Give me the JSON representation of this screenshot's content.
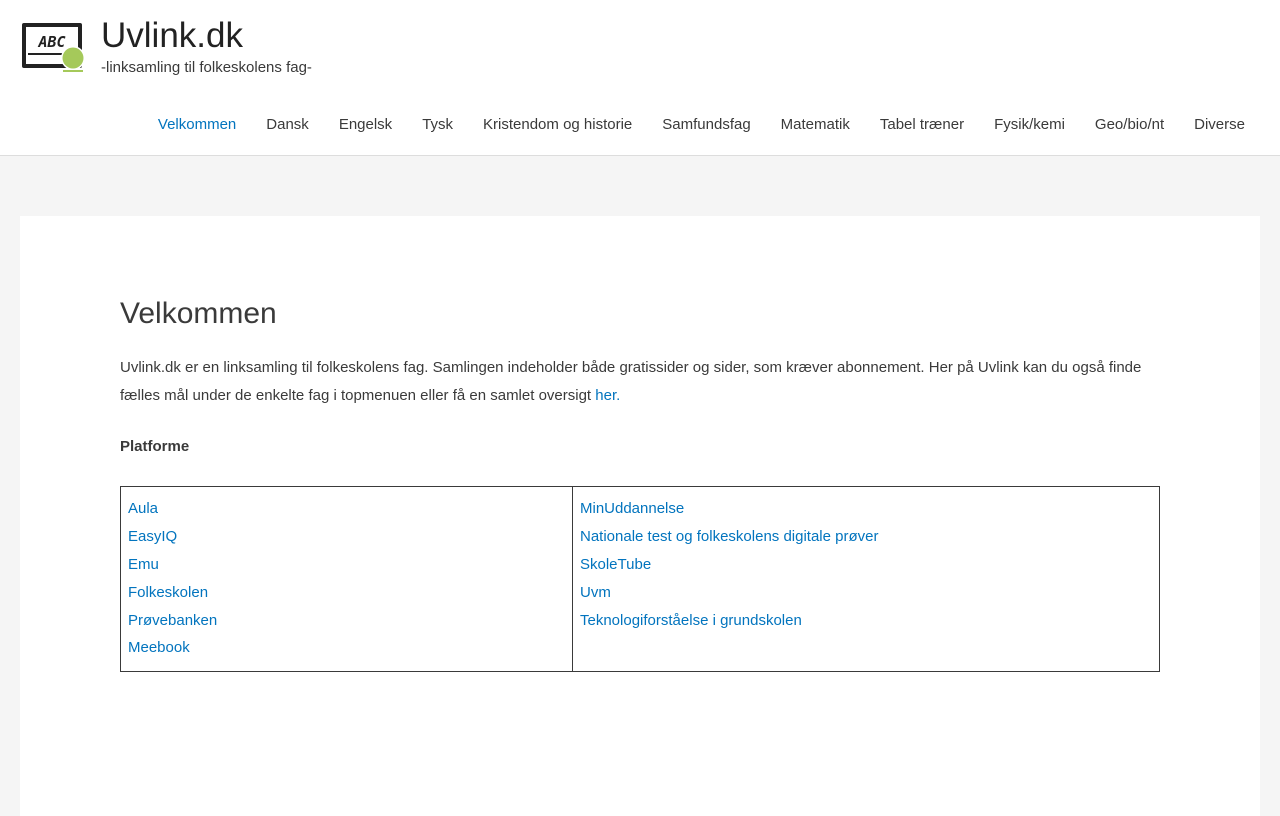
{
  "site": {
    "title": "Uvlink.dk",
    "tagline": "-linksamling til folkeskolens fag-",
    "logo_text": "ABC",
    "logo_accent": "#a5c95a"
  },
  "nav": {
    "items": [
      {
        "label": "Velkommen",
        "active": true
      },
      {
        "label": "Dansk"
      },
      {
        "label": "Engelsk"
      },
      {
        "label": "Tysk"
      },
      {
        "label": "Kristendom og historie"
      },
      {
        "label": "Samfundsfag"
      },
      {
        "label": "Matematik"
      },
      {
        "label": "Tabel træner"
      },
      {
        "label": "Fysik/kemi"
      },
      {
        "label": "Geo/bio/nt"
      },
      {
        "label": "Diverse"
      }
    ]
  },
  "page": {
    "title": "Velkommen",
    "intro_text": "Uvlink.dk er en linksamling til folkeskolens fag. Samlingen indeholder både gratissider og sider, som kræver abonnement. Her på Uvlink kan du også finde fælles mål under de enkelte fag i topmenuen eller få en samlet oversigt ",
    "intro_link": "her.",
    "section_heading": "Platforme"
  },
  "platforms": {
    "left": [
      "Aula",
      "EasyIQ",
      "Emu",
      "Folkeskolen",
      "Prøvebanken",
      "Meebook"
    ],
    "right": [
      "MinUddannelse",
      "Nationale test og folkeskolens digitale prøver",
      "SkoleTube",
      "Uvm",
      "Teknologiforståelse i grundskolen"
    ]
  },
  "colors": {
    "link": "#0274be",
    "text": "#3a3a3a",
    "background": "#f5f5f5"
  }
}
